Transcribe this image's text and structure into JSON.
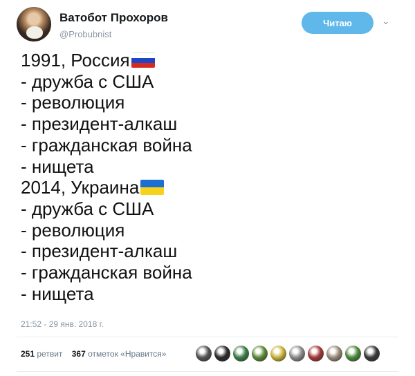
{
  "profile": {
    "name": "Ватобот Прохоров",
    "handle": "@Probubnist",
    "follow_label": "Читаю",
    "avatar_icon": "user-avatar"
  },
  "tweet": {
    "lines": [
      "1991, Россия",
      "- дружба с США",
      "- революция",
      "- президент-алкаш",
      "- гражданская война",
      "- нищета",
      "2014, Украина",
      "- дружба с США",
      "- революция",
      "- президент-алкаш",
      "- гражданская война",
      "- нищета"
    ],
    "flags": [
      "russia-flag-icon",
      "ukraine-flag-icon"
    ],
    "timestamp": "21:52 - 29 янв. 2018 г."
  },
  "stats": {
    "retweets_count": "251",
    "retweets_label": "ретвит",
    "likes_count": "367",
    "likes_label": "отметок «Нравится»"
  },
  "likers": [
    {
      "color": "#555555"
    },
    {
      "color": "#2b2b2b"
    },
    {
      "color": "#3c7d4a"
    },
    {
      "color": "#5f8a3a"
    },
    {
      "color": "#c9b23a"
    },
    {
      "color": "#8c8c8c"
    },
    {
      "color": "#a33a3a"
    },
    {
      "color": "#9a8c7a"
    },
    {
      "color": "#4f8a3d"
    },
    {
      "color": "#3a3a3a"
    }
  ],
  "colors": {
    "accent": "#60b7ea",
    "text": "#14171a",
    "muted": "#8a96a3"
  }
}
